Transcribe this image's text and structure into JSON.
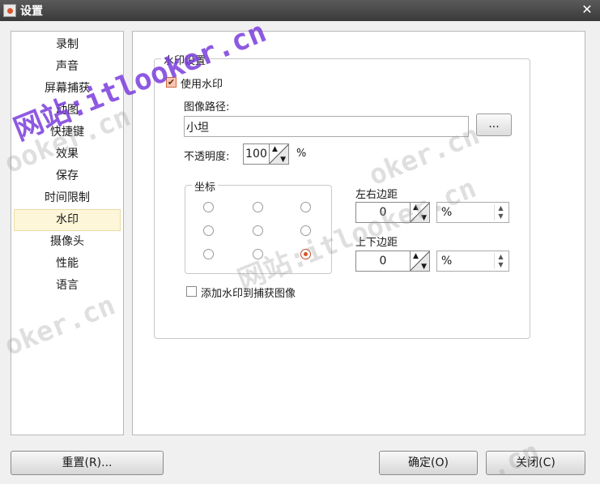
{
  "window": {
    "title": "设置",
    "close_glyph": "✕"
  },
  "sidebar": {
    "items": [
      {
        "label": "录制"
      },
      {
        "label": "声音"
      },
      {
        "label": "屏幕捕获"
      },
      {
        "label": "动图"
      },
      {
        "label": "快捷键"
      },
      {
        "label": "效果"
      },
      {
        "label": "保存"
      },
      {
        "label": "时间限制"
      },
      {
        "label": "水印",
        "active": true
      },
      {
        "label": "摄像头"
      },
      {
        "label": "性能"
      },
      {
        "label": "语言"
      }
    ]
  },
  "watermark": {
    "group_title": "水印设置",
    "use_watermark_label": "使用水印",
    "use_watermark_checked": true,
    "checkmark_glyph": "✔",
    "image_path_label": "图像路径:",
    "image_path_value": "小坦",
    "browse_label": "...",
    "opacity_label": "不透明度:",
    "opacity_value": "100",
    "opacity_unit": "%",
    "coordinates": {
      "title": "坐标",
      "selected_position": "bottom-right"
    },
    "horizontal_margin_label": "左右边距",
    "horizontal_margin_value": "0",
    "horizontal_margin_unit": "%",
    "vertical_margin_label": "上下边距",
    "vertical_margin_value": "0",
    "vertical_margin_unit": "%",
    "add_to_capture_label": "添加水印到捕获图像",
    "add_to_capture_checked": false
  },
  "buttons": {
    "reset": "重置(R)...",
    "ok": "确定(O)",
    "close": "关闭(C)"
  },
  "overlay_text": {
    "purple": "网站:itlooker.cn",
    "gray": "网站:itlooker.cn",
    "gray_fragment_1": "ooker.cn",
    "gray_fragment_2": "oker.cn",
    "gray_fragment_3": ".cn"
  },
  "colors": {
    "accent": "#d9532c",
    "active_item_bg": "#fdf6d8",
    "titlebar": "#3a3a3a",
    "purple_watermark": "#7a3cdc"
  }
}
